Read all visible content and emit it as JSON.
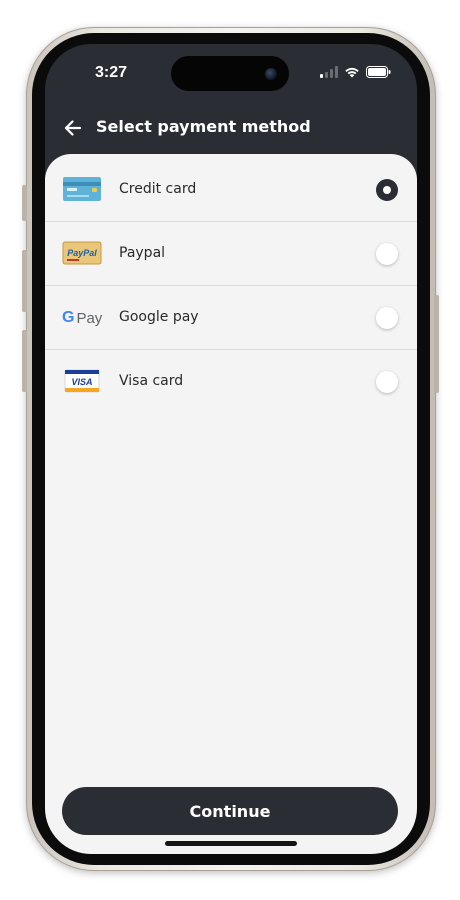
{
  "status_bar": {
    "time": "3:27"
  },
  "header": {
    "title": "Select payment method",
    "back_icon": "arrow-left-icon"
  },
  "payment_methods": [
    {
      "label": "Credit card",
      "icon": "credit-card-icon",
      "selected": true
    },
    {
      "label": "Paypal",
      "icon": "paypal-icon",
      "icon_text": "PayPal",
      "selected": false
    },
    {
      "label": "Google pay",
      "icon": "google-pay-icon",
      "icon_text": "Pay",
      "selected": false
    },
    {
      "label": "Visa card",
      "icon": "visa-card-icon",
      "icon_text": "VISA",
      "selected": false
    }
  ],
  "footer": {
    "continue_label": "Continue"
  },
  "colors": {
    "primary_dark": "#2b2d35",
    "sheet_bg": "#f4f4f4"
  }
}
